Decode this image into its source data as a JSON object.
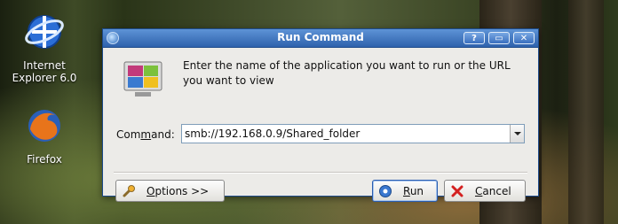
{
  "desktop": {
    "icons": [
      {
        "label_line1": "Internet",
        "label_line2": "Explorer 6.0",
        "icon": "internet-explorer-icon"
      },
      {
        "label": "Firefox",
        "icon": "firefox-icon"
      }
    ]
  },
  "dialog": {
    "title": "Run Command",
    "title_buttons": {
      "help": "?",
      "maximize": "▭",
      "close": "✕"
    },
    "description": "Enter the name of the application you want to run or the URL you want to view",
    "command_label_prefix": "Com",
    "command_label_underlined": "m",
    "command_label_suffix": "and:",
    "command_value": "smb://192.168.0.9/Shared_folder",
    "options_label_underlined": "O",
    "options_label_rest": "ptions >>",
    "run_label_underlined": "R",
    "run_label_rest": "un",
    "cancel_label_underlined": "C",
    "cancel_label_rest": "ancel"
  },
  "colors": {
    "titlebar": "#2f62ad",
    "window_bg": "#ecebe8"
  }
}
